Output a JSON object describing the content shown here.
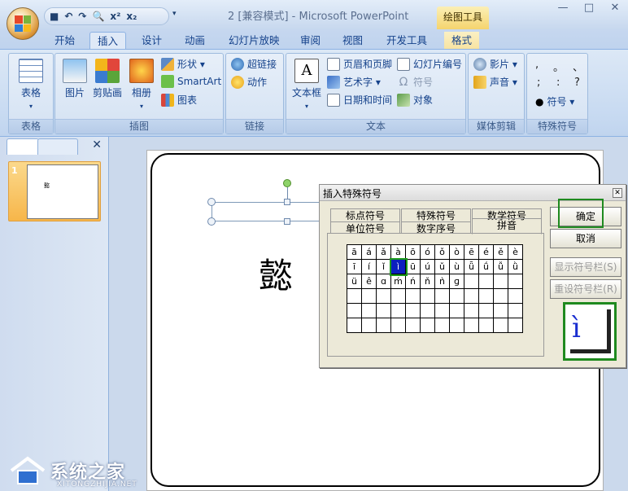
{
  "window": {
    "title": "2 [兼容模式] - Microsoft PowerPoint",
    "context_tab_group": "绘图工具",
    "controls": [
      "—",
      "□",
      "✕"
    ]
  },
  "qat": {
    "items": [
      "■",
      "↶",
      "↷",
      "🔍",
      "x²",
      "x₂"
    ],
    "dropdown": "▾"
  },
  "tabs": [
    {
      "label": "开始"
    },
    {
      "label": "插入"
    },
    {
      "label": "设计"
    },
    {
      "label": "动画"
    },
    {
      "label": "幻灯片放映"
    },
    {
      "label": "审阅"
    },
    {
      "label": "视图"
    },
    {
      "label": "开发工具"
    },
    {
      "label": "格式"
    }
  ],
  "ribbon": {
    "groups": {
      "tables": {
        "label": "表格",
        "table_btn": "表格"
      },
      "illustrations": {
        "label": "插图",
        "picture": "图片",
        "clipart": "剪贴画",
        "album": "相册",
        "shapes": "形状 ▾",
        "smartart": "SmartArt",
        "chart": "图表"
      },
      "links": {
        "label": "链接",
        "hyperlink": "超链接",
        "action": "动作"
      },
      "text": {
        "label": "文本",
        "textbox": "文本框",
        "header_footer": "页眉和页脚",
        "wordart": "艺术字 ▾",
        "datetime": "日期和时间",
        "slide_number": "幻灯片编号",
        "symbol": "符号",
        "object": "对象"
      },
      "media": {
        "label": "媒体剪辑",
        "movie": "影片 ▾",
        "sound": "声音 ▾"
      },
      "special": {
        "label": "特殊符号",
        "symbols": [
          ",",
          "。",
          "、",
          ";",
          ":",
          "?"
        ],
        "symbol_btn": "符号 ▾"
      }
    }
  },
  "slide": {
    "number": "1",
    "character": "懿"
  },
  "dialog": {
    "title": "插入特殊符号",
    "close": "✕",
    "tabs_row1": [
      "标点符号",
      "特殊符号",
      "数学符号"
    ],
    "tabs_row2": [
      "单位符号",
      "数字序号",
      "拼音"
    ],
    "grid": [
      [
        "ā",
        "á",
        "ǎ",
        "à",
        "ō",
        "ó",
        "ǒ",
        "ò",
        "ē",
        "é",
        "ě",
        "è"
      ],
      [
        "ī",
        "í",
        "ǐ",
        "ì",
        "ū",
        "ú",
        "ǔ",
        "ù",
        "ǖ",
        "ǘ",
        "ǚ",
        "ǜ"
      ],
      [
        "ü",
        "ê",
        "ɑ",
        "ḿ",
        "ń",
        "ň",
        "ǹ",
        "ɡ",
        "",
        "",
        "",
        ""
      ],
      [
        "",
        "",
        "",
        "",
        "",
        "",
        "",
        "",
        "",
        "",
        "",
        ""
      ],
      [
        "",
        "",
        "",
        "",
        "",
        "",
        "",
        "",
        "",
        "",
        "",
        ""
      ],
      [
        "",
        "",
        "",
        "",
        "",
        "",
        "",
        "",
        "",
        "",
        "",
        ""
      ]
    ],
    "selected": {
      "row": 1,
      "col": 3
    },
    "buttons": {
      "ok": "确定",
      "cancel": "取消",
      "show_bar": "显示符号栏(S)",
      "reset_bar": "重设符号栏(R)"
    },
    "preview": "ì"
  },
  "watermark": {
    "main": "系统之家",
    "sub": "XITONGZHIJIA.NET"
  }
}
